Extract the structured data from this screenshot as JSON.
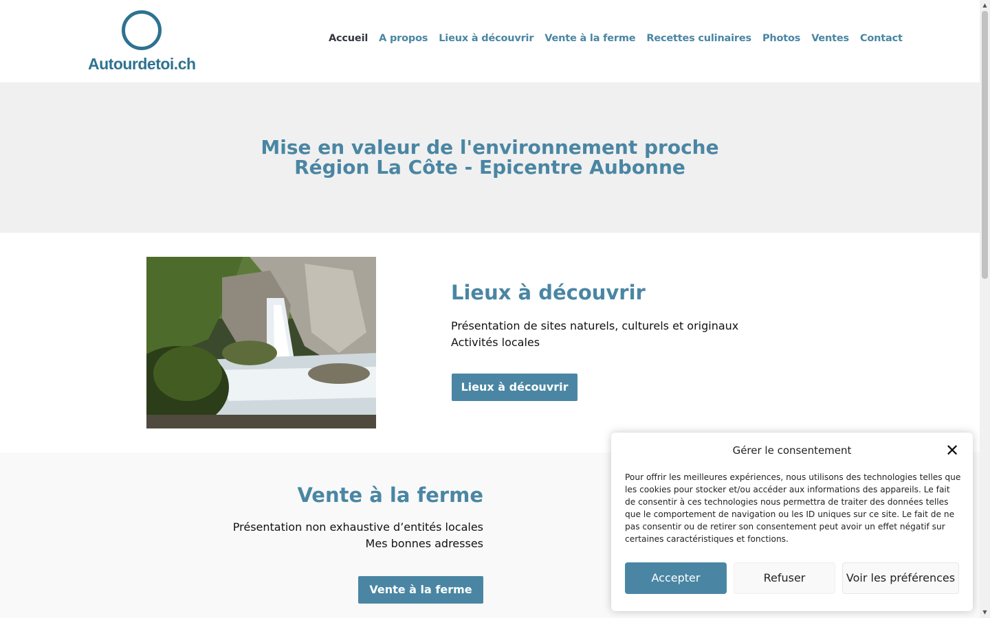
{
  "header": {
    "logo_text": "Autourdetoi.ch",
    "nav": [
      {
        "label": "Accueil",
        "active": true
      },
      {
        "label": "A propos"
      },
      {
        "label": "Lieux à découvrir"
      },
      {
        "label": "Vente à la ferme"
      },
      {
        "label": "Recettes culinaires"
      },
      {
        "label": "Photos"
      },
      {
        "label": "Ventes"
      },
      {
        "label": "Contact"
      }
    ]
  },
  "hero": {
    "line1": "Mise en valeur de l'environnement proche",
    "line2": "Région La Côte - Epicentre Aubonne"
  },
  "section_lieux": {
    "title": "Lieux à découvrir",
    "line1": "Présentation de sites naturels, culturels et originaux",
    "line2": "Activités locales",
    "button": "Lieux à découvrir"
  },
  "section_vente": {
    "title": "Vente à la ferme",
    "line1": "Présentation non exhaustive d’entités locales",
    "line2": "Mes bonnes adresses",
    "button": "Vente à la ferme"
  },
  "consent": {
    "title": "Gérer le consentement",
    "body": "Pour offrir les meilleures expériences, nous utilisons des technologies telles que les cookies pour stocker et/ou accéder aux informations des appareils. Le fait de consentir à ces technologies nous permettra de traiter des données telles que le comportement de navigation ou les ID uniques sur ce site. Le fait de ne pas consentir ou de retirer son consentement peut avoir un effet négatif sur certaines caractéristiques et fonctions.",
    "accept": "Accepter",
    "refuse": "Refuser",
    "preferences": "Voir les préférences"
  },
  "colors": {
    "accent": "#4a86a3",
    "logo": "#2e7290",
    "hero_bg": "#f0f0f0",
    "nav_active": "#33373d"
  }
}
